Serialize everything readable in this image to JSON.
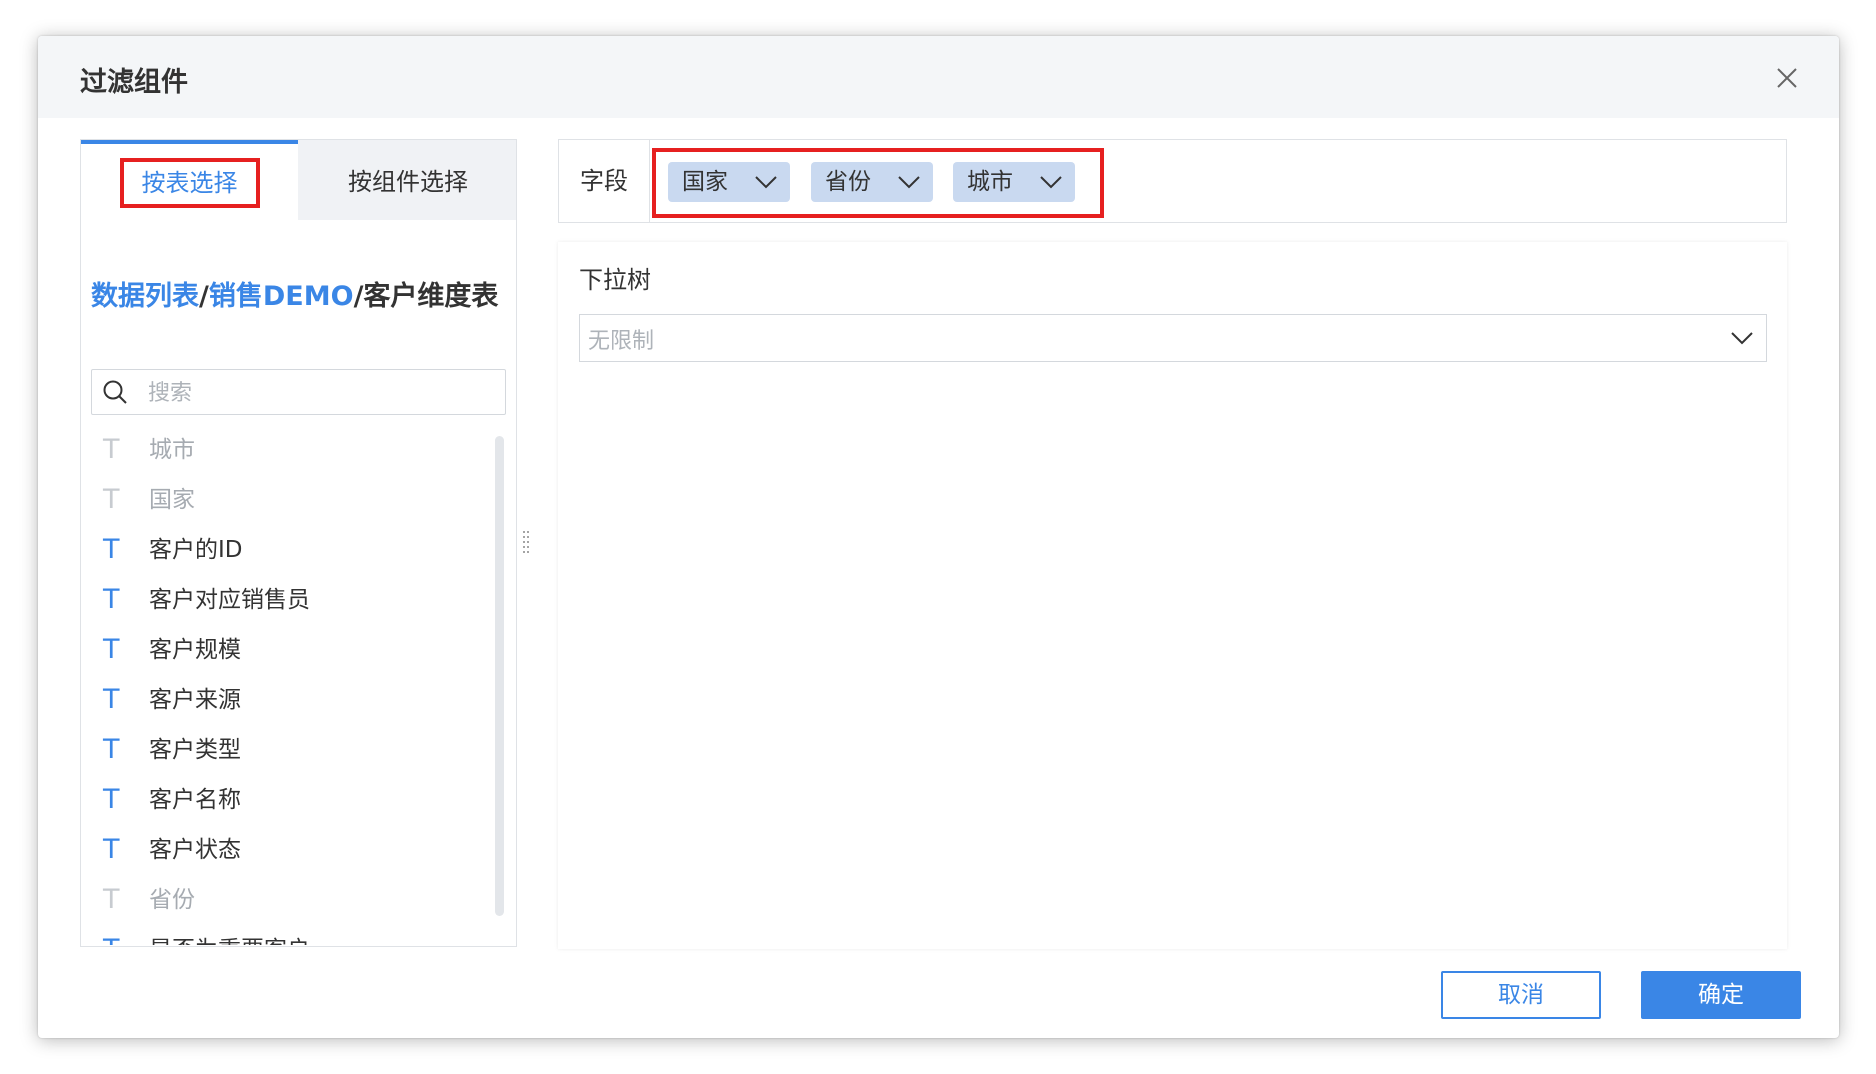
{
  "dialog": {
    "title": "过滤组件"
  },
  "tabs": [
    {
      "label": "按表选择",
      "active": true
    },
    {
      "label": "按组件选择",
      "active": false
    }
  ],
  "breadcrumb": {
    "part1": "数据列表",
    "sep1": "/",
    "part2": "销售DEMO",
    "sep2": "/",
    "current": "客户维度表"
  },
  "search": {
    "placeholder": "搜索",
    "value": ""
  },
  "fields": [
    {
      "label": "城市",
      "icon": "T",
      "disabled": true
    },
    {
      "label": "国家",
      "icon": "T",
      "disabled": true
    },
    {
      "label": "客户的ID",
      "icon": "T",
      "disabled": false
    },
    {
      "label": "客户对应销售员",
      "icon": "T",
      "disabled": false
    },
    {
      "label": "客户规模",
      "icon": "T",
      "disabled": false
    },
    {
      "label": "客户来源",
      "icon": "T",
      "disabled": false
    },
    {
      "label": "客户类型",
      "icon": "T",
      "disabled": false
    },
    {
      "label": "客户名称",
      "icon": "T",
      "disabled": false
    },
    {
      "label": "客户状态",
      "icon": "T",
      "disabled": false
    },
    {
      "label": "省份",
      "icon": "T",
      "disabled": true
    },
    {
      "label": "是否为重要客户",
      "icon": "T",
      "disabled": false
    }
  ],
  "field_bar": {
    "label": "字段",
    "chips": [
      "国家",
      "省份",
      "城市"
    ]
  },
  "config": {
    "label": "下拉树",
    "select_value": "无限制"
  },
  "buttons": {
    "cancel": "取消",
    "ok": "确定"
  },
  "colors": {
    "accent": "#3a86e6",
    "highlight": "#e62020",
    "chip_bg": "#c9d9f0"
  }
}
